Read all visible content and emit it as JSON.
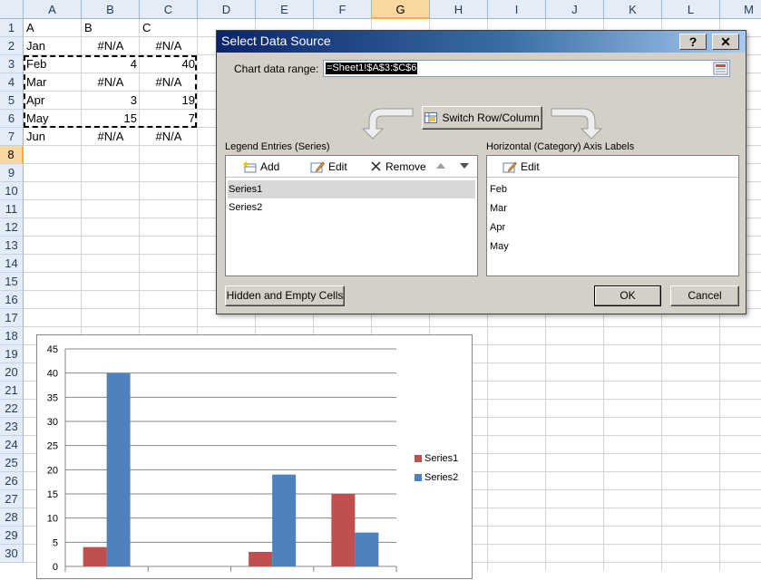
{
  "sheet": {
    "columns": [
      "A",
      "B",
      "C",
      "D",
      "E",
      "F",
      "G",
      "H",
      "I",
      "J",
      "K",
      "L",
      "M"
    ],
    "rows": [
      "1",
      "2",
      "3",
      "4",
      "5",
      "6",
      "7",
      "8",
      "9",
      "10",
      "11",
      "12",
      "13",
      "14",
      "15",
      "16",
      "17",
      "18",
      "19",
      "20",
      "21",
      "22",
      "23",
      "24",
      "25",
      "26",
      "27",
      "28",
      "29",
      "30"
    ],
    "selected_column": "G",
    "selected_row": "8",
    "cells": [
      [
        "A",
        "B",
        "C"
      ],
      [
        "Jan",
        "#N/A",
        "#N/A"
      ],
      [
        "Feb",
        "4",
        "40"
      ],
      [
        "Mar",
        "#N/A",
        "#N/A"
      ],
      [
        "Apr",
        "3",
        "19"
      ],
      [
        "May",
        "15",
        "7"
      ],
      [
        "Jun",
        "#N/A",
        "#N/A"
      ]
    ]
  },
  "chart_data": {
    "type": "bar",
    "categories": [
      "",
      "",
      "",
      ""
    ],
    "series": [
      {
        "name": "Series1",
        "color": "#c0504d",
        "values": [
          4,
          null,
          3,
          15
        ]
      },
      {
        "name": "Series2",
        "color": "#4f81bd",
        "values": [
          40,
          null,
          19,
          7
        ]
      }
    ],
    "ylim": [
      0,
      45
    ],
    "yticks": [
      "0",
      "5",
      "10",
      "15",
      "20",
      "25",
      "30",
      "35",
      "40",
      "45"
    ],
    "grid": true,
    "legend_position": "right"
  },
  "dialog": {
    "title": "Select Data Source",
    "help_label": "?",
    "close_label": "✕",
    "range_label": "Chart data range:",
    "range_value": "=Sheet1!$A$3:$C$6",
    "switch_label": "Switch Row/Column",
    "legend_section_label": "Legend Entries (Series)",
    "axis_section_label": "Horizontal (Category) Axis Labels",
    "add_label": "Add",
    "edit_label": "Edit",
    "remove_label": "Remove",
    "axis_edit_label": "Edit",
    "series_list": [
      "Series1",
      "Series2"
    ],
    "axis_list": [
      "Feb",
      "Mar",
      "Apr",
      "May"
    ],
    "hidden_cells_label": "Hidden and Empty Cells",
    "ok_label": "OK",
    "cancel_label": "Cancel"
  },
  "colors": {
    "series1": "#c0504d",
    "series2": "#4f81bd",
    "title_bar_start": "#0a246a",
    "header_selected": "#f9d99f"
  }
}
